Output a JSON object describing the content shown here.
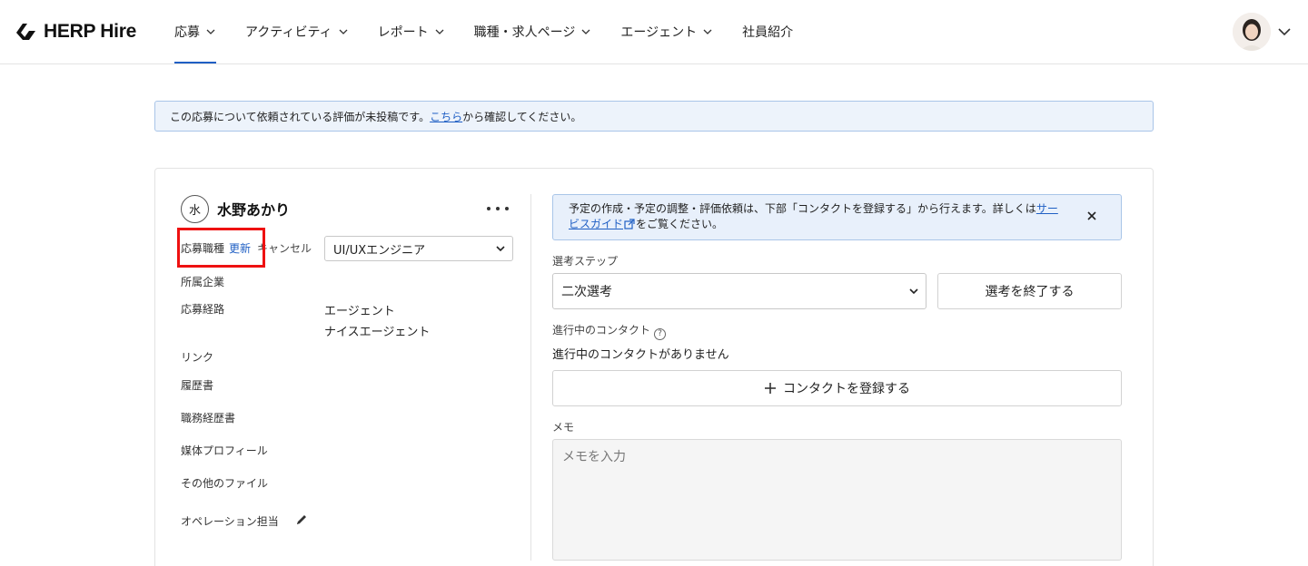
{
  "header": {
    "brand": "HERP Hire",
    "nav": [
      {
        "label": "応募",
        "has_dropdown": true,
        "active": true
      },
      {
        "label": "アクティビティ",
        "has_dropdown": true
      },
      {
        "label": "レポート",
        "has_dropdown": true
      },
      {
        "label": "職種・求人ページ",
        "has_dropdown": true
      },
      {
        "label": "エージェント",
        "has_dropdown": true
      },
      {
        "label": "社員紹介",
        "has_dropdown": false
      }
    ],
    "avatar_icon": "user-avatar"
  },
  "alert": {
    "text_before": "この応募について依頼されている評価が未投稿です。",
    "link": "こちら",
    "text_after": "から確認してください。"
  },
  "candidate": {
    "initial": "水",
    "name": "水野あかり",
    "more_icon": "more-horizontal-icon",
    "job_label": "応募職種",
    "update_label": "更新",
    "cancel_label": "キャンセル",
    "job_value": "UI/UXエンジニア",
    "company_label": "所属企業",
    "route_label": "応募経路",
    "route_value_1": "エージェント",
    "route_value_2": "ナイスエージェント",
    "link_label": "リンク",
    "resume_label": "履歴書",
    "cv_label": "職務経歴書",
    "media_label": "媒体プロフィール",
    "other_files_label": "その他のファイル",
    "operator_label": "オペレーション担当"
  },
  "right": {
    "info_line1": "予定の作成・予定の調整・評価依頼は、下部「コンタクトを登録する」から行えます。詳しくは",
    "info_link_a": "サー",
    "info_link_b": "ビスガイド",
    "info_after": "をご覧ください。",
    "step_label": "選考ステップ",
    "step_value": "二次選考",
    "end_button": "選考を終了する",
    "contact_label": "進行中のコンタクト",
    "contact_empty": "進行中のコンタクトがありません",
    "add_contact_button": "コンタクトを登録する",
    "memo_label": "メモ",
    "memo_placeholder": "メモを入力"
  },
  "colors": {
    "accent": "#1f5fc4",
    "highlight": "#ee1111",
    "alert_bg": "#edf3fb"
  }
}
